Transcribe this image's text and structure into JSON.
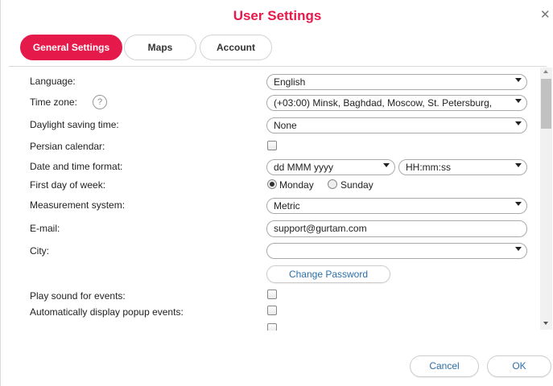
{
  "dialog": {
    "title": "User Settings",
    "close_icon": "close-icon"
  },
  "tabs": [
    {
      "label": "General Settings",
      "active": true
    },
    {
      "label": "Maps",
      "active": false
    },
    {
      "label": "Account",
      "active": false
    }
  ],
  "settings": {
    "language": {
      "label": "Language:",
      "value": "English"
    },
    "time_zone": {
      "label": "Time zone:",
      "help": "?",
      "value": "(+03:00) Minsk, Baghdad, Moscow, St. Petersburg,"
    },
    "dst": {
      "label": "Daylight saving time:",
      "value": "None"
    },
    "persian": {
      "label": "Persian calendar:",
      "checked": false
    },
    "datetime": {
      "label": "Date and time format:",
      "date_value": "dd MMM yyyy",
      "time_value": "HH:mm:ss"
    },
    "first_day": {
      "label": "First day of week:",
      "options": [
        "Monday",
        "Sunday"
      ],
      "selected": "Monday"
    },
    "measurement": {
      "label": "Measurement system:",
      "value": "Metric"
    },
    "email": {
      "label": "E-mail:",
      "value": "support@gurtam.com"
    },
    "city": {
      "label": "City:",
      "value": ""
    },
    "change_password": "Change Password",
    "play_sound": {
      "label": "Play sound for events:",
      "checked": false
    },
    "popup_events": {
      "label": "Automatically display popup events:",
      "checked": false
    }
  },
  "footer": {
    "cancel": "Cancel",
    "ok": "OK"
  },
  "colors": {
    "accent": "#e5194a",
    "link": "#2c6fa8"
  }
}
